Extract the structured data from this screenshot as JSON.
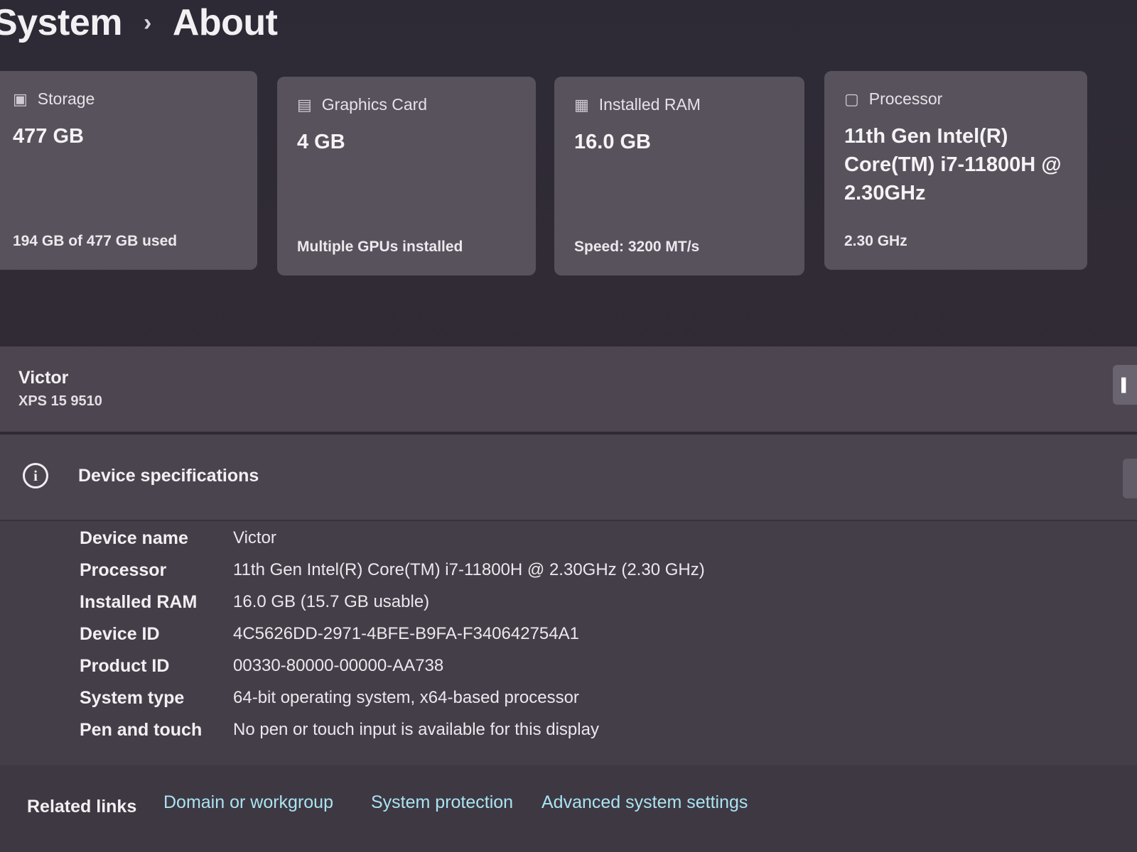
{
  "breadcrumb": {
    "parent": "System",
    "separator": "›",
    "current": "About"
  },
  "cards": [
    {
      "icon": "storage-icon",
      "label": "Storage",
      "value": "477 GB",
      "sub": "194 GB of 477 GB used"
    },
    {
      "icon": "graphics-card-icon",
      "label": "Graphics Card",
      "value": "4 GB",
      "sub": "Multiple GPUs installed"
    },
    {
      "icon": "ram-icon",
      "label": "Installed RAM",
      "value": "16.0 GB",
      "sub": "Speed: 3200 MT/s"
    },
    {
      "icon": "processor-icon",
      "label": "Processor",
      "value": "11th Gen Intel(R) Core(TM) i7-11800H @ 2.30GHz",
      "sub": "2.30 GHz"
    }
  ],
  "device": {
    "name": "Victor",
    "model": "XPS 15 9510"
  },
  "specs": {
    "title": "Device specifications",
    "rows": [
      {
        "label": "Device name",
        "value": "Victor"
      },
      {
        "label": "Processor",
        "value": "11th Gen Intel(R) Core(TM) i7-11800H @ 2.30GHz (2.30 GHz)"
      },
      {
        "label": "Installed RAM",
        "value": "16.0 GB (15.7 GB usable)"
      },
      {
        "label": "Device ID",
        "value": "4C5626DD-2971-4BFE-B9FA-F340642754A1"
      },
      {
        "label": "Product ID",
        "value": "00330-80000-00000-AA738"
      },
      {
        "label": "System type",
        "value": "64-bit operating system, x64-based processor"
      },
      {
        "label": "Pen and touch",
        "value": "No pen or touch input is available for this display"
      }
    ]
  },
  "related": {
    "label": "Related links",
    "links": [
      "Domain or workgroup",
      "System protection",
      "Advanced system settings"
    ],
    "link_color": "#a9e4f2"
  }
}
